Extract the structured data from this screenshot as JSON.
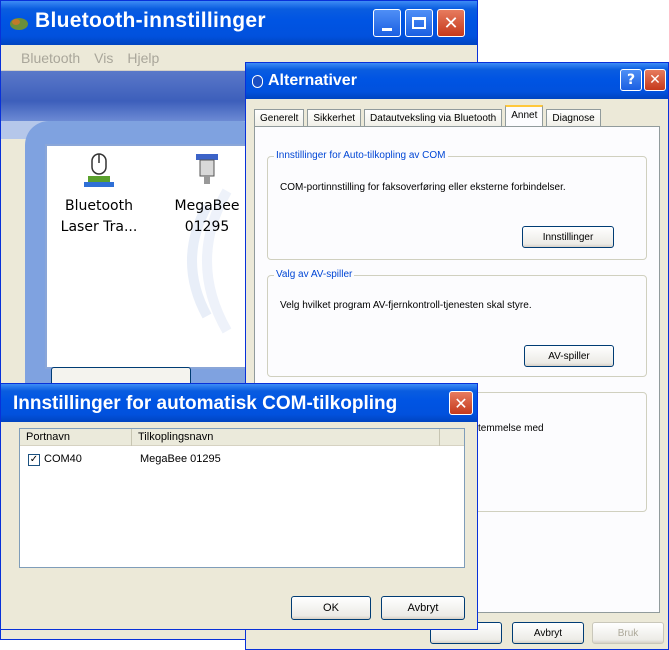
{
  "main_window": {
    "title": "Bluetooth-innstillinger",
    "menu": [
      "Bluetooth",
      "Vis",
      "Hjelp"
    ],
    "devices": [
      {
        "line1": "Bluetooth",
        "line2": "Laser Tra...",
        "icon": "mouse-icon"
      },
      {
        "line1": "MegaBee",
        "line2": "01295",
        "icon": "serial-port-icon"
      }
    ]
  },
  "options_dialog": {
    "title": "Alternativer",
    "tabs": [
      "Generelt",
      "Sikkerhet",
      "Datautveksling via Bluetooth",
      "Annet",
      "Diagnose"
    ],
    "active_tab": "Annet",
    "auto_com": {
      "heading": "Innstillinger for Auto-tilkopling av COM",
      "text": "COM-portinnstilling for faksoverføring eller eksterne forbindelser.",
      "button": "Innstillinger"
    },
    "av_player": {
      "heading": "Valg av AV-spiller",
      "text": "Velg hvilket program AV-fjernkontroll-tjenesten skal styre.",
      "button": "AV-spiller"
    },
    "third_group": {
      "text": "temmelse med"
    },
    "footer": {
      "cancel": "Avbryt",
      "apply": "Bruk"
    }
  },
  "com_dialog": {
    "title": "Innstillinger for automatisk COM-tilkopling",
    "columns": [
      "Portnavn",
      "Tilkoplingsnavn"
    ],
    "rows": [
      {
        "port": "COM40",
        "name": "MegaBee 01295",
        "checked": true
      }
    ],
    "ok": "OK",
    "cancel": "Avbryt"
  },
  "colors": {
    "titlebar": "#0054e3",
    "close": "#c5391c",
    "face": "#ece9d8"
  }
}
